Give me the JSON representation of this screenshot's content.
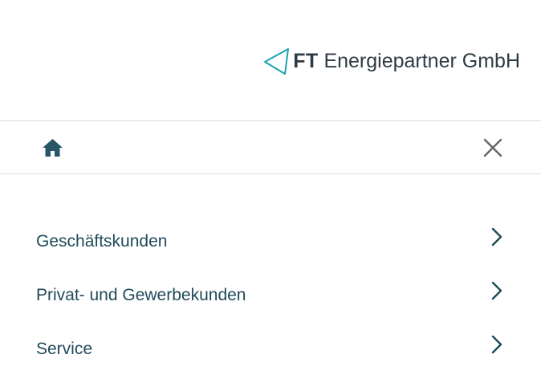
{
  "header": {
    "logo_strong": "FT",
    "logo_text": "Energiepartner GmbH",
    "logo_icon": "triangle-logo-icon",
    "logo_accent": "#19a3b4"
  },
  "navbar": {
    "home_icon": "home-icon",
    "close_icon": "close-icon"
  },
  "menu": {
    "items": [
      {
        "label": "Geschäftskunden",
        "icon": "chevron-right-icon"
      },
      {
        "label": "Privat- und Gewerbekunden",
        "icon": "chevron-right-icon"
      },
      {
        "label": "Service",
        "icon": "chevron-right-icon"
      }
    ]
  },
  "colors": {
    "text": "#1f4a5a",
    "logo_text": "#2f3b43",
    "icon": "#2a5566",
    "close": "#666666",
    "divider": "#dcdcdc",
    "background": "#ffffff"
  }
}
